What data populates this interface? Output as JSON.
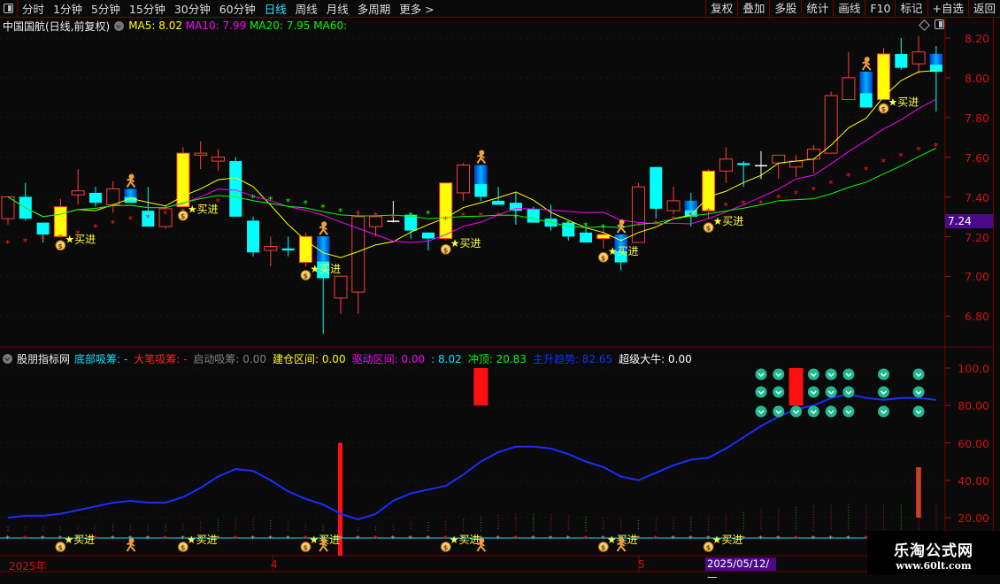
{
  "toolbar": {
    "periods": [
      "分时",
      "1分钟",
      "5分钟",
      "15分钟",
      "30分钟",
      "60分钟",
      "日线",
      "周线",
      "月线",
      "多周期",
      "更多 >"
    ],
    "active": "日线",
    "right_buttons": [
      "复权",
      "叠加",
      "多股",
      "统计",
      "画线",
      "F10",
      "标记",
      "+自选",
      "返回"
    ]
  },
  "main": {
    "stock": "中国国航(日线,前复权)",
    "ma5": "MA5: 8.02",
    "ma10": "MA10: 7.99",
    "ma20": "MA20: 7.95",
    "ma60": "MA60:",
    "price_ticks": [
      "8.20",
      "8.00",
      "7.80",
      "7.60",
      "7.40",
      "7.20",
      "7.00",
      "6.80"
    ],
    "current_price": "7.24",
    "buy_label": "买进"
  },
  "indicator": {
    "name": "股朋指标网",
    "items": [
      {
        "label": "底部吸筹: -",
        "color": "#00e5ff"
      },
      {
        "label": "大笔吸筹: -",
        "color": "#ff2020"
      },
      {
        "label": "启动吸筹: 0.00",
        "color": "#808080"
      },
      {
        "label": "建仓区间: 0.00",
        "color": "#ffff00"
      },
      {
        "label": "驱动区间: 0.00",
        "color": "#ff00ff"
      },
      {
        "label": ": 8.02",
        "color": "#00e5ff"
      },
      {
        "label": "冲顶: 20.83",
        "color": "#00ff00"
      },
      {
        "label": "主升趋势: 82.65",
        "color": "#1030ff"
      },
      {
        "label": "超级大牛: 0.00",
        "color": "#ffffff"
      }
    ],
    "ticks": [
      "100.0",
      "80.00",
      "60.00",
      "40.00",
      "20.00"
    ]
  },
  "time_axis": {
    "labels": [
      "2025年",
      "4",
      "5"
    ],
    "cursor_date": "2025/05/12/—"
  },
  "watermark": {
    "title": "乐淘公式网",
    "url": "www.60lt.com"
  },
  "colors": {
    "up": "#ff3c3c",
    "down": "#00ffff",
    "ma5": "#ffff00",
    "ma10": "#ff00ff",
    "ma20": "#00ff00",
    "trend": "#1a2cff"
  },
  "chart_data": {
    "type": "candlestick",
    "ylim": [
      6.8,
      8.2
    ],
    "candles": [
      [
        "u",
        7.29,
        7.4,
        7.26,
        7.4
      ],
      [
        "d",
        7.4,
        7.29,
        7.28,
        7.47
      ],
      [
        "d",
        7.27,
        7.21,
        7.17,
        7.27
      ],
      [
        "y",
        7.2,
        7.35,
        7.2,
        7.39
      ],
      [
        "u",
        7.41,
        7.43,
        7.36,
        7.54
      ],
      [
        "d",
        7.42,
        7.37,
        7.35,
        7.45
      ],
      [
        "u",
        7.36,
        7.44,
        7.32,
        7.48
      ],
      [
        "b",
        7.44,
        7.37,
        7.37,
        7.44
      ],
      [
        "d",
        7.33,
        7.25,
        7.25,
        7.45
      ],
      [
        "u",
        7.25,
        7.34,
        7.24,
        7.36
      ],
      [
        "y",
        7.35,
        7.62,
        7.35,
        7.65
      ],
      [
        "u",
        7.61,
        7.62,
        7.54,
        7.68
      ],
      [
        "u",
        7.58,
        7.6,
        7.53,
        7.64
      ],
      [
        "d",
        7.58,
        7.3,
        7.3,
        7.6
      ],
      [
        "d",
        7.28,
        7.12,
        7.1,
        7.3
      ],
      [
        "u",
        7.13,
        7.15,
        7.05,
        7.2
      ],
      [
        "d",
        7.14,
        7.13,
        7.1,
        7.2
      ],
      [
        "y",
        7.07,
        7.2,
        7.05,
        7.22
      ],
      [
        "b",
        7.2,
        6.99,
        6.71,
        7.2
      ],
      [
        "u",
        6.89,
        7.0,
        6.81,
        7.0
      ],
      [
        "u",
        6.92,
        7.3,
        6.81,
        7.32
      ],
      [
        "u",
        7.25,
        7.3,
        7.2,
        7.3
      ],
      [
        "w",
        7.28,
        7.28,
        7.27,
        7.38
      ],
      [
        "d",
        7.31,
        7.23,
        7.19,
        7.31
      ],
      [
        "d",
        7.22,
        7.19,
        7.13,
        7.22
      ],
      [
        "y",
        7.19,
        7.47,
        7.18,
        7.47
      ],
      [
        "u",
        7.42,
        7.56,
        7.38,
        7.57
      ],
      [
        "b",
        7.56,
        7.4,
        7.38,
        7.56
      ],
      [
        "d",
        7.38,
        7.36,
        7.36,
        7.45
      ],
      [
        "d",
        7.37,
        7.33,
        7.26,
        7.42
      ],
      [
        "d",
        7.34,
        7.27,
        7.27,
        7.35
      ],
      [
        "d",
        7.29,
        7.25,
        7.23,
        7.36
      ],
      [
        "d",
        7.27,
        7.2,
        7.18,
        7.27
      ],
      [
        "d",
        7.22,
        7.17,
        7.17,
        7.26
      ],
      [
        "y",
        7.19,
        7.21,
        7.14,
        7.25
      ],
      [
        "b",
        7.21,
        7.07,
        7.03,
        7.21
      ],
      [
        "u",
        7.17,
        7.45,
        7.17,
        7.47
      ],
      [
        "d",
        7.55,
        7.34,
        7.29,
        7.55
      ],
      [
        "u",
        7.33,
        7.38,
        7.31,
        7.45
      ],
      [
        "b",
        7.38,
        7.3,
        7.25,
        7.42
      ],
      [
        "y",
        7.33,
        7.53,
        7.29,
        7.54
      ],
      [
        "u",
        7.53,
        7.59,
        7.47,
        7.65
      ],
      [
        "d",
        7.57,
        7.56,
        7.45,
        7.58
      ],
      [
        "w",
        7.56,
        7.56,
        7.49,
        7.63
      ],
      [
        "u",
        7.57,
        7.61,
        7.49,
        7.61
      ],
      [
        "u",
        7.55,
        7.58,
        7.5,
        7.61
      ],
      [
        "u",
        7.59,
        7.64,
        7.52,
        7.66
      ],
      [
        "u",
        7.62,
        7.91,
        7.62,
        7.93
      ],
      [
        "u",
        7.89,
        8.0,
        7.89,
        8.13
      ],
      [
        "b",
        8.03,
        7.85,
        7.85,
        8.03
      ],
      [
        "y",
        7.89,
        8.12,
        7.89,
        8.15
      ],
      [
        "d",
        8.12,
        8.05,
        8.04,
        8.2
      ],
      [
        "u",
        8.07,
        8.13,
        8.02,
        8.21
      ],
      [
        "b",
        8.12,
        8.03,
        7.83,
        8.16
      ]
    ],
    "stars": [
      [
        7.17,
        "r"
      ],
      [
        7.18,
        "r"
      ],
      [
        7.19,
        "r"
      ],
      [
        7.2,
        "r"
      ],
      [
        7.22,
        "r"
      ],
      [
        7.25,
        "r"
      ],
      [
        7.27,
        "r"
      ],
      [
        7.29,
        "r"
      ],
      [
        7.3,
        "r"
      ],
      [
        7.32,
        "r"
      ],
      [
        7.33,
        "r"
      ],
      [
        7.35,
        "r"
      ],
      [
        7.38,
        "r"
      ],
      [
        7.41,
        "g"
      ],
      [
        7.4,
        "g"
      ],
      [
        7.39,
        "g"
      ],
      [
        7.38,
        "g"
      ],
      [
        7.37,
        "g"
      ],
      [
        7.35,
        "g"
      ],
      [
        7.33,
        "g"
      ],
      [
        7.32,
        "r"
      ],
      [
        7.31,
        "r"
      ],
      [
        7.3,
        "r"
      ],
      [
        7.31,
        "g"
      ],
      [
        7.32,
        "g"
      ],
      [
        7.29,
        "r"
      ],
      [
        7.31,
        "r"
      ],
      [
        7.31,
        "r"
      ],
      [
        7.31,
        "r"
      ],
      [
        7.3,
        "g"
      ],
      [
        7.29,
        "g"
      ],
      [
        7.28,
        "g"
      ],
      [
        7.27,
        "g"
      ],
      [
        7.26,
        "g"
      ],
      [
        7.25,
        "g"
      ],
      [
        7.25,
        "g"
      ],
      [
        7.26,
        "r"
      ],
      [
        7.27,
        "r"
      ],
      [
        7.29,
        "r"
      ],
      [
        7.31,
        "r"
      ],
      [
        7.33,
        "r"
      ],
      [
        7.36,
        "r"
      ],
      [
        7.37,
        "r"
      ],
      [
        7.37,
        "r"
      ],
      [
        7.4,
        "r"
      ],
      [
        7.42,
        "r"
      ],
      [
        7.44,
        "r"
      ],
      [
        7.47,
        "r"
      ],
      [
        7.51,
        "r"
      ],
      [
        7.54,
        "r"
      ],
      [
        7.58,
        "r"
      ],
      [
        7.61,
        "r"
      ],
      [
        7.64,
        "r"
      ],
      [
        7.66,
        "r"
      ]
    ],
    "buy_signals": [
      3,
      10,
      17,
      25,
      34,
      40,
      50
    ],
    "runner_signals": [
      7,
      18,
      27,
      35,
      49
    ],
    "lower": {
      "ylim": [
        10,
        105
      ],
      "trend": [
        20,
        21,
        21,
        22,
        24,
        26,
        28,
        29,
        28,
        28,
        31,
        36,
        42,
        46,
        45,
        40,
        34,
        30,
        27,
        22,
        19,
        22,
        29,
        33,
        35,
        37,
        43,
        50,
        55,
        58,
        58,
        57,
        54,
        50,
        47,
        42,
        40,
        44,
        48,
        51,
        52,
        57,
        63,
        69,
        74,
        78,
        80,
        84,
        86,
        84,
        83,
        84,
        84,
        83
      ],
      "red_blocks": [
        27,
        45
      ],
      "red_bar": 19,
      "check_columns": [
        43,
        44,
        46,
        47,
        48,
        50,
        52
      ],
      "check_row3_extra": [
        45
      ],
      "bottom_buys": [
        3,
        10,
        17,
        25,
        34,
        40
      ],
      "bottom_runners": [
        7,
        18,
        27,
        35
      ]
    }
  }
}
